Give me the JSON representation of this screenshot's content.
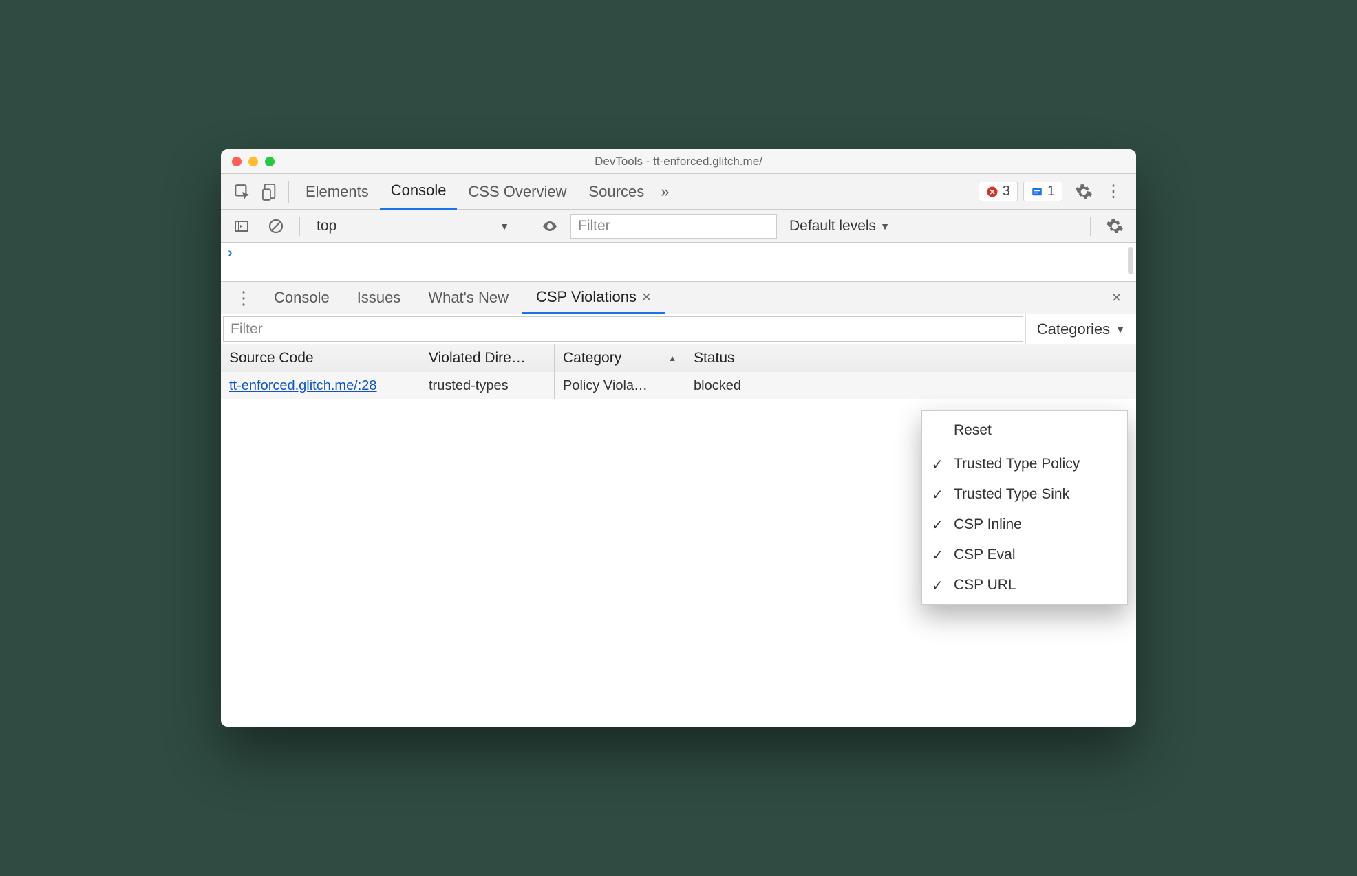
{
  "window_title": "DevTools - tt-enforced.glitch.me/",
  "main_tabs": {
    "items": [
      "Elements",
      "Console",
      "CSS Overview",
      "Sources"
    ],
    "active": "Console",
    "more": "»"
  },
  "badges": {
    "errors": "3",
    "issues": "1"
  },
  "console_toolbar": {
    "context": "top",
    "filter_placeholder": "Filter",
    "levels": "Default levels"
  },
  "drawer": {
    "tabs": [
      "Console",
      "Issues",
      "What's New",
      "CSP Violations"
    ],
    "active": "CSP Violations",
    "filter_placeholder": "Filter",
    "categories_label": "Categories"
  },
  "table": {
    "headers": [
      "Source Code",
      "Violated Dire…",
      "Category",
      "Status"
    ],
    "rows": [
      {
        "source": "tt-enforced.glitch.me/:28",
        "directive": "trusted-types",
        "category": "Policy Viola…",
        "status": "blocked"
      }
    ]
  },
  "categories_menu": {
    "reset": "Reset",
    "items": [
      "Trusted Type Policy",
      "Trusted Type Sink",
      "CSP Inline",
      "CSP Eval",
      "CSP URL"
    ]
  }
}
